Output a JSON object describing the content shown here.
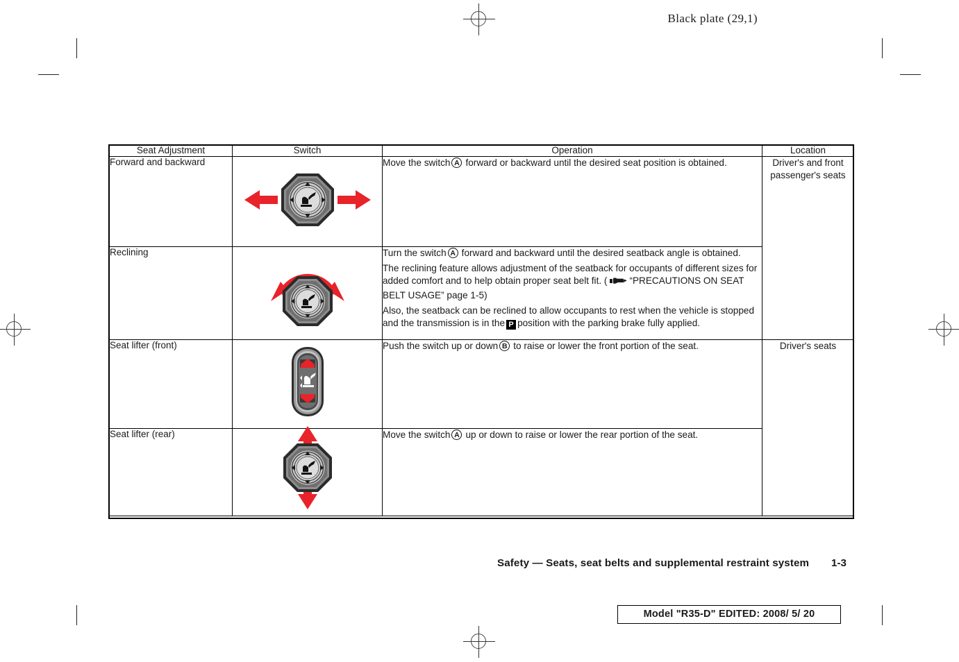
{
  "page": {
    "plate_note": "Black plate (29,1)",
    "footer_title": "Safety — Seats, seat belts and supplemental restraint system",
    "footer_page": "1-3",
    "model_stamp": "Model \"R35-D\"  EDITED:  2008/ 5/ 20"
  },
  "table": {
    "headers": {
      "seat_adjustment": "Seat Adjustment",
      "switch": "Switch",
      "operation": "Operation",
      "location": "Location"
    },
    "rows": [
      {
        "adjustment": "Forward and backward",
        "switch_icon": "rocker-knob-switch-horizontal",
        "operation_lines": [
          "Move the switch (A) forward or backward until the desired seat position is obtained."
        ],
        "op1_pre": "Move the switch",
        "op1_badge": "A",
        "op1_post": "forward or backward until the desired seat position is obtained."
      },
      {
        "adjustment": "Reclining",
        "switch_icon": "rocker-knob-switch-rotary",
        "op1_pre": "Turn the switch",
        "op1_badge": "A",
        "op1_post": "forward and backward until the desired seatback angle is obtained.",
        "op2_pre": "The reclining feature allows adjustment of the seatback for occupants of different sizes for added comfort and to help obtain proper seat belt fit. (",
        "op2_ref": "“PRECAUTIONS ON SEAT BELT USAGE” page 1-5)",
        "op3_pre": "Also, the seatback can be reclined to allow occupants to rest when the vehicle is stopped and the transmission is in the",
        "op3_badge": "P",
        "op3_post": "position with the parking brake fully applied."
      },
      {
        "adjustment": "Seat lifter (front)",
        "switch_icon": "vertical-rocker-switch",
        "op1_pre": "Push the switch up or down",
        "op1_badge": "B",
        "op1_post": "to raise or lower the front portion of the seat."
      },
      {
        "adjustment": "Seat lifter (rear)",
        "switch_icon": "rocker-knob-switch-vertical",
        "op1_pre": "Move the switch",
        "op1_badge": "A",
        "op1_post": "up or down to raise or lower the rear portion of the seat."
      }
    ],
    "locations": [
      "Driver's and front passenger's seats",
      "Driver's seats"
    ]
  },
  "colors": {
    "arrow_red": "#e8232a",
    "knob_grey": "#b9b9b9",
    "knob_dark": "#6b6b6b",
    "ink": "#1a1a1a"
  }
}
